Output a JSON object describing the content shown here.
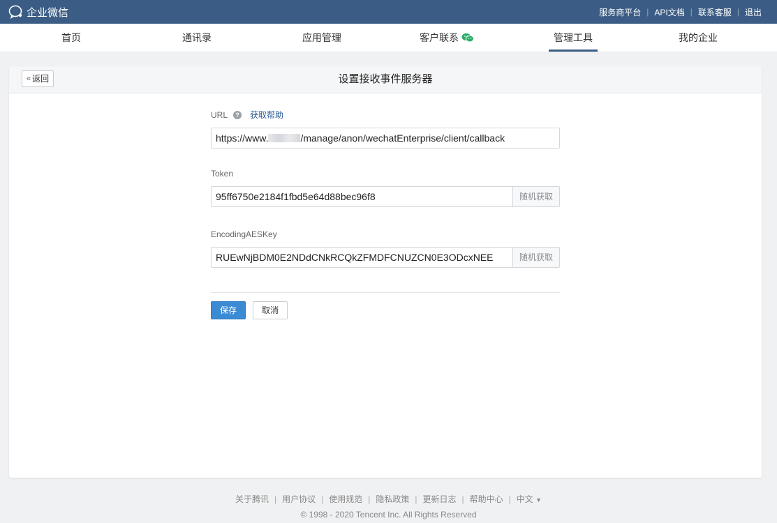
{
  "header": {
    "logo_text": "企业微信",
    "links": [
      "服务商平台",
      "API文档",
      "联系客服",
      "退出"
    ]
  },
  "nav": {
    "items": [
      "首页",
      "通讯录",
      "应用管理",
      "客户联系",
      "管理工具",
      "我的企业"
    ],
    "active": "管理工具"
  },
  "page": {
    "back_label": "返回",
    "title": "设置接收事件服务器"
  },
  "form": {
    "url_label": "URL",
    "help_link": "获取帮助",
    "url_prefix": "https://www.",
    "url_suffix": "/manage/anon/wechatEnterprise/client/callback",
    "token_label": "Token",
    "token_value": "95ff6750e2184f1fbd5e64d88bec96f8",
    "aes_label": "EncodingAESKey",
    "aes_value": "RUEwNjBDM0E2NDdCNkRCQkZFMDFCNUZCN0E3ODcxNEE",
    "random_btn": "随机获取",
    "save": "保存",
    "cancel": "取消"
  },
  "footer": {
    "links": [
      "关于腾讯",
      "用户协议",
      "使用规范",
      "隐私政策",
      "更新日志",
      "帮助中心",
      "中文"
    ],
    "copyright": "© 1998 - 2020 Tencent Inc. All Rights Reserved"
  },
  "colors": {
    "topbar": "#3b5d85",
    "primary": "#3a8ad4",
    "link": "#2b5a97"
  }
}
